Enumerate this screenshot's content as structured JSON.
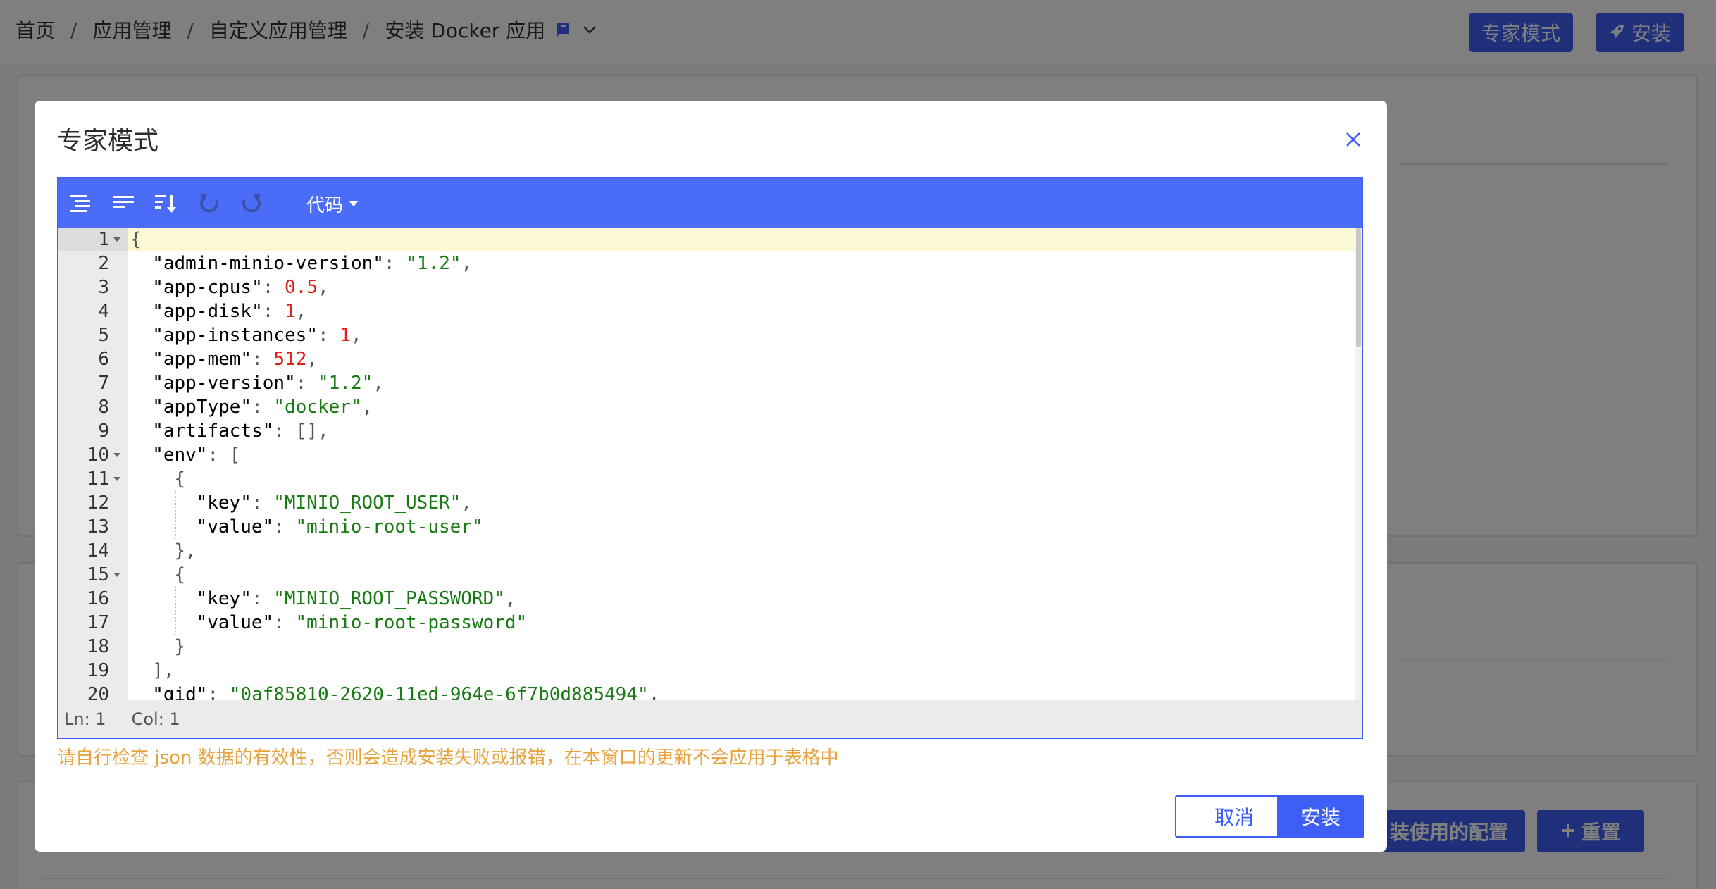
{
  "breadcrumb": {
    "items": [
      "首页",
      "应用管理",
      "自定义应用管理",
      "安装 Docker 应用"
    ],
    "separator": "/",
    "book_icon": "book-icon",
    "chevron_icon": "chevron-down-icon"
  },
  "header_buttons": {
    "expert_label": "专家模式",
    "install_label": "安装",
    "install_icon": "rocket-icon"
  },
  "background_buttons": {
    "config_label": "装使用的配置",
    "reset_label": "重置",
    "reset_icon": "plus-icon"
  },
  "modal": {
    "title": "专家模式",
    "close_icon": "close-icon",
    "toolbar": {
      "format_icon": "format-icon",
      "compact_icon": "compact-icon",
      "sort_icon": "sort-icon",
      "undo_icon": "undo-icon",
      "redo_icon": "redo-icon",
      "mode_label": "代码"
    },
    "code_lines": [
      {
        "n": "1",
        "fold": true,
        "tokens": [
          [
            "p",
            "{"
          ]
        ]
      },
      {
        "n": "2",
        "indent": 1,
        "tokens": [
          [
            "k",
            "\"admin-minio-version\""
          ],
          [
            "p",
            ": "
          ],
          [
            "s",
            "\"1.2\""
          ],
          [
            "p",
            ","
          ]
        ]
      },
      {
        "n": "3",
        "indent": 1,
        "tokens": [
          [
            "k",
            "\"app-cpus\""
          ],
          [
            "p",
            ": "
          ],
          [
            "n",
            "0.5"
          ],
          [
            "p",
            ","
          ]
        ]
      },
      {
        "n": "4",
        "indent": 1,
        "tokens": [
          [
            "k",
            "\"app-disk\""
          ],
          [
            "p",
            ": "
          ],
          [
            "n",
            "1"
          ],
          [
            "p",
            ","
          ]
        ]
      },
      {
        "n": "5",
        "indent": 1,
        "tokens": [
          [
            "k",
            "\"app-instances\""
          ],
          [
            "p",
            ": "
          ],
          [
            "n",
            "1"
          ],
          [
            "p",
            ","
          ]
        ]
      },
      {
        "n": "6",
        "indent": 1,
        "tokens": [
          [
            "k",
            "\"app-mem\""
          ],
          [
            "p",
            ": "
          ],
          [
            "n",
            "512"
          ],
          [
            "p",
            ","
          ]
        ]
      },
      {
        "n": "7",
        "indent": 1,
        "tokens": [
          [
            "k",
            "\"app-version\""
          ],
          [
            "p",
            ": "
          ],
          [
            "s",
            "\"1.2\""
          ],
          [
            "p",
            ","
          ]
        ]
      },
      {
        "n": "8",
        "indent": 1,
        "tokens": [
          [
            "k",
            "\"appType\""
          ],
          [
            "p",
            ": "
          ],
          [
            "s",
            "\"docker\""
          ],
          [
            "p",
            ","
          ]
        ]
      },
      {
        "n": "9",
        "indent": 1,
        "tokens": [
          [
            "k",
            "\"artifacts\""
          ],
          [
            "p",
            ": "
          ],
          [
            "p",
            "[]"
          ],
          [
            "p",
            ","
          ]
        ]
      },
      {
        "n": "10",
        "fold": true,
        "indent": 1,
        "tokens": [
          [
            "k",
            "\"env\""
          ],
          [
            "p",
            ": "
          ],
          [
            "p",
            "["
          ]
        ]
      },
      {
        "n": "11",
        "fold": true,
        "indent": 2,
        "tokens": [
          [
            "p",
            "{"
          ]
        ]
      },
      {
        "n": "12",
        "indent": 3,
        "tokens": [
          [
            "k",
            "\"key\""
          ],
          [
            "p",
            ": "
          ],
          [
            "s",
            "\"MINIO_ROOT_USER\""
          ],
          [
            "p",
            ","
          ]
        ]
      },
      {
        "n": "13",
        "indent": 3,
        "tokens": [
          [
            "k",
            "\"value\""
          ],
          [
            "p",
            ": "
          ],
          [
            "s",
            "\"minio-root-user\""
          ]
        ]
      },
      {
        "n": "14",
        "indent": 2,
        "tokens": [
          [
            "p",
            "},"
          ]
        ]
      },
      {
        "n": "15",
        "fold": true,
        "indent": 2,
        "tokens": [
          [
            "p",
            "{"
          ]
        ]
      },
      {
        "n": "16",
        "indent": 3,
        "tokens": [
          [
            "k",
            "\"key\""
          ],
          [
            "p",
            ": "
          ],
          [
            "s",
            "\"MINIO_ROOT_PASSWORD\""
          ],
          [
            "p",
            ","
          ]
        ]
      },
      {
        "n": "17",
        "indent": 3,
        "tokens": [
          [
            "k",
            "\"value\""
          ],
          [
            "p",
            ": "
          ],
          [
            "s",
            "\"minio-root-password\""
          ]
        ]
      },
      {
        "n": "18",
        "indent": 2,
        "tokens": [
          [
            "p",
            "}"
          ]
        ]
      },
      {
        "n": "19",
        "indent": 1,
        "tokens": [
          [
            "p",
            "],"
          ]
        ]
      },
      {
        "n": "20",
        "indent": 1,
        "tokens": [
          [
            "k",
            "\"gid\""
          ],
          [
            "p",
            ": "
          ],
          [
            "s",
            "\"0af85810-2620-11ed-964e-6f7b0d885494\""
          ],
          [
            "p",
            ","
          ]
        ]
      }
    ],
    "status": {
      "ln": "Ln: 1",
      "col": "Col: 1"
    },
    "warning": "请自行检查 json 数据的有效性，否则会造成安装失败或报错，在本窗口的更新不会应用于表格中",
    "cancel_label": "取消",
    "install_label": "安装"
  },
  "colors": {
    "primary": "#3f5ef5",
    "toolbar": "#4a6cf7",
    "warning": "#e8a33c",
    "string": "#1a7a14",
    "number": "#e0201b"
  }
}
